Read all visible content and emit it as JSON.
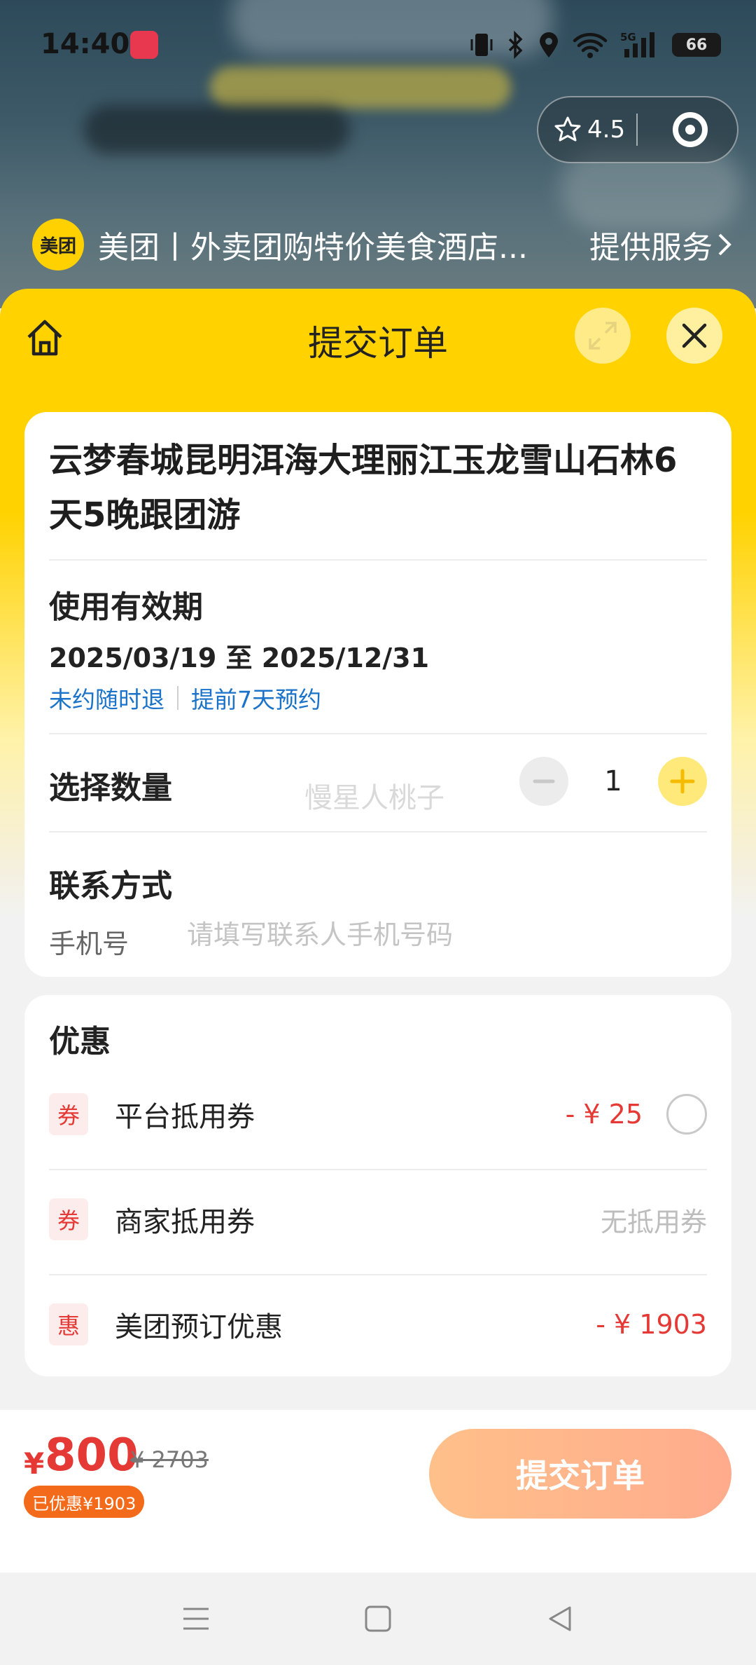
{
  "status_bar": {
    "time": "14:40",
    "battery": "66",
    "network": "5G"
  },
  "mini_program": {
    "rating": "4.5"
  },
  "provider": {
    "logo_text": "美团",
    "name": "美团丨外卖团购特价美食酒店...",
    "service_label": "提供服务"
  },
  "sheet": {
    "title": "提交订单"
  },
  "product": {
    "title": "云梦春城昆明洱海大理丽江玉龙雪山石林6天5晚跟团游",
    "validity_label": "使用有效期",
    "validity_range": "2025/03/19 至 2025/12/31",
    "tags": [
      "未约随时退",
      "提前7天预约"
    ]
  },
  "quantity": {
    "label": "选择数量",
    "value": "1"
  },
  "watermark": "慢星人桃子",
  "contact": {
    "label": "联系方式",
    "phone_label": "手机号",
    "phone_placeholder": "请填写联系人手机号码",
    "phone_value": ""
  },
  "discounts": {
    "title": "优惠",
    "items": [
      {
        "badge": "券",
        "label": "平台抵用券",
        "amount": "- ¥ 25"
      },
      {
        "badge": "券",
        "label": "商家抵用券",
        "note": "无抵用券"
      },
      {
        "badge": "惠",
        "label": "美团预订优惠",
        "amount": "- ¥ 1903"
      }
    ]
  },
  "footer": {
    "currency": "¥",
    "price": "800",
    "original_price": "¥ 2703",
    "saved_text": "已优惠¥1903",
    "submit_label": "提交订单"
  },
  "colors": {
    "brand_yellow": "#ffd200",
    "price_red": "#e53935",
    "link_blue": "#1a73c8",
    "submit_gradient_start": "#ffc08a",
    "submit_gradient_end": "#ffab8c"
  }
}
